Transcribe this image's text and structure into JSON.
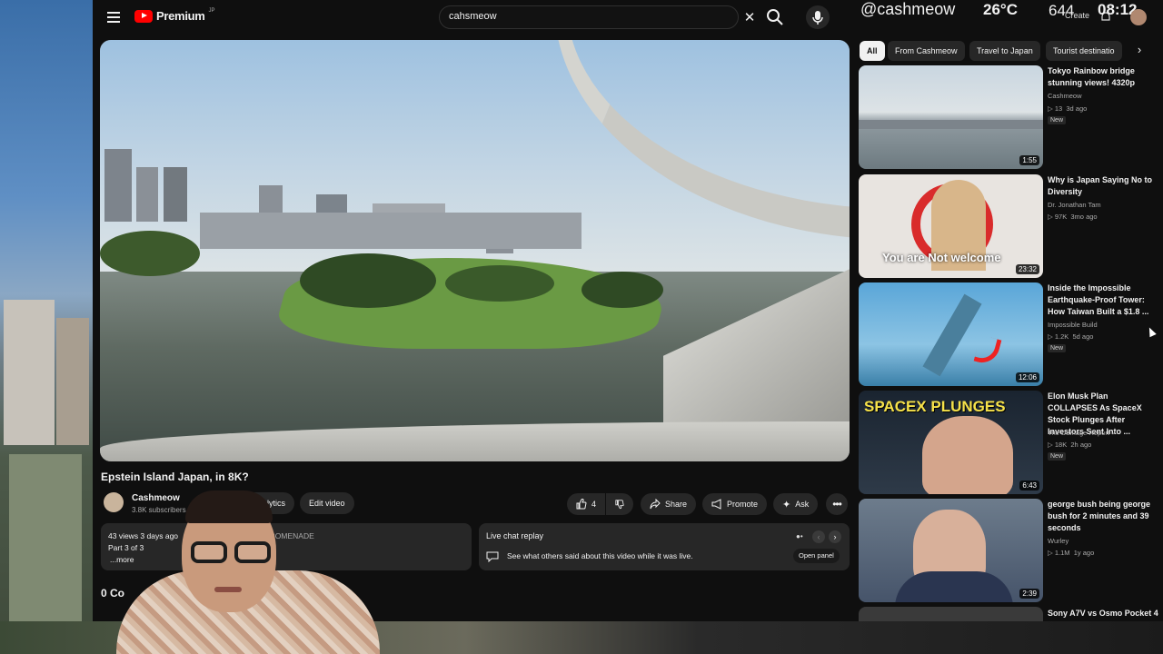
{
  "header": {
    "logo_text": "Premium",
    "logo_region": "JP",
    "search_value": "cahsmeow",
    "menu_icon": "hamburger-menu-icon",
    "search_icon": "search-icon",
    "mic_icon": "mic-icon",
    "clear_icon": "close-icon"
  },
  "overlay": {
    "handle": "@cashmeow",
    "temperature": "26°C",
    "count": "644",
    "create_label": "Create",
    "time": "08:12"
  },
  "video": {
    "title": "Epstein Island Japan, in 8K?",
    "channel_name": "Cashmeow",
    "subscribers": "3.8K subscribers",
    "analytics_label": "Analytics",
    "edit_label": "Edit video",
    "like_count": "4",
    "share_label": "Share",
    "promote_label": "Promote",
    "ask_label": "Ask",
    "description": {
      "stats": "43 views  3 days ago",
      "location": "PROMENADE",
      "part": "Part 3 of 3",
      "more": "...more"
    },
    "chat": {
      "title": "Live chat replay",
      "text": "See what others said about this video while it was live.",
      "open_label": "Open panel"
    },
    "comments_heading": "0 Co"
  },
  "chips": [
    "All",
    "From Cashmeow",
    "Travel to Japan",
    "Tourist destinatio"
  ],
  "recommendations": [
    {
      "title": "Tokyo Rainbow bridge stunning views! 4320p",
      "channel": "Cashmeow",
      "views": "13",
      "age": "3d ago",
      "new": "New",
      "duration": "1:55"
    },
    {
      "title": "Why is Japan Saying No to Diversity",
      "channel": "Dr. Jonathan Tam",
      "views": "97K",
      "age": "3mo ago",
      "new": "",
      "duration": "23:32",
      "thumb_text": "You are Not welcome"
    },
    {
      "title": "Inside the Impossible Earthquake-Proof Tower: How Taiwan Built a $1.8 ...",
      "channel": "Impossible Build",
      "views": "1.2K",
      "age": "5d ago",
      "new": "New",
      "duration": "12:06"
    },
    {
      "title": "Elon Musk Plan COLLAPSES As SpaceX Stock Plunges After Investors Sent Into ...",
      "channel": "The Damage Report",
      "views": "18K",
      "age": "2h ago",
      "new": "New",
      "duration": "6:43",
      "thumb_text": "SPACEX PLUNGES"
    },
    {
      "title": "george bush being george bush for 2 minutes and 39 seconds",
      "channel": "Wurley",
      "views": "1.1M",
      "age": "1y ago",
      "new": "",
      "duration": "2:39"
    }
  ],
  "last_recommendation_title": "Sony A7V vs Osmo Pocket 4"
}
